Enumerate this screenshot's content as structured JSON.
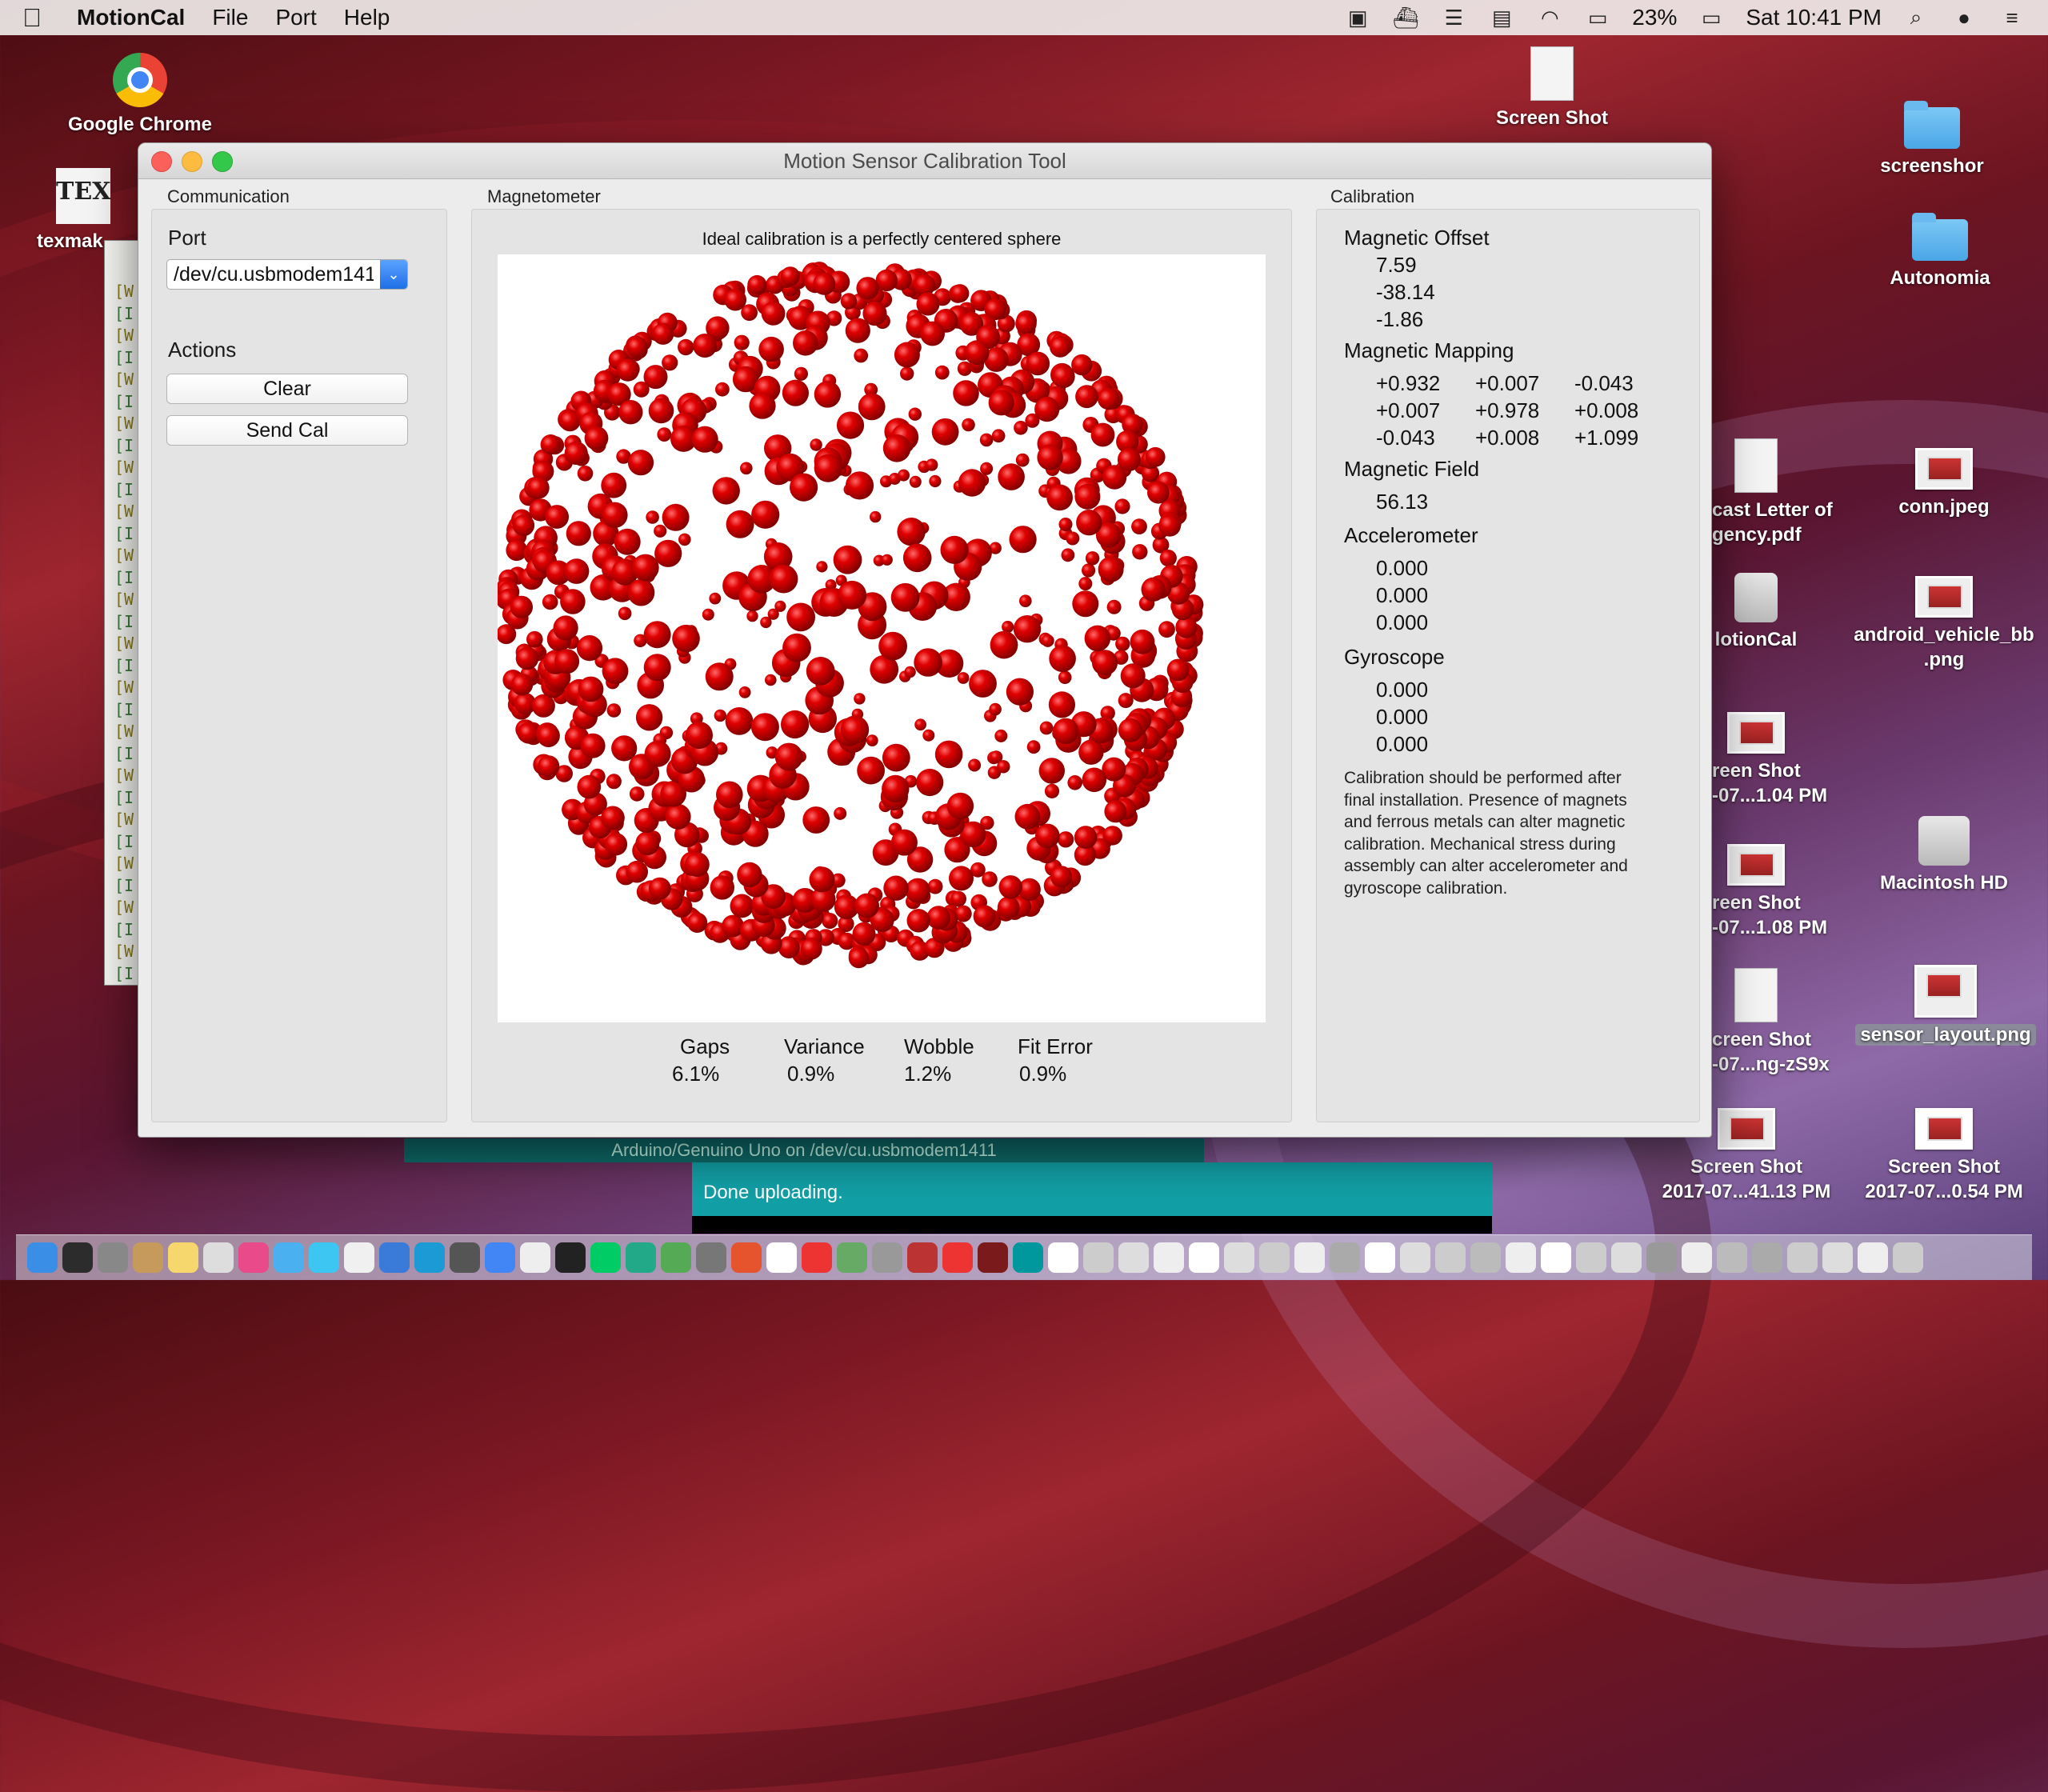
{
  "menubar": {
    "app_name": "MotionCal",
    "menus": [
      "File",
      "Port",
      "Help"
    ],
    "battery": "23%",
    "clock": "Sat 10:41 PM"
  },
  "desktop": {
    "icons": {
      "chrome": "Google Chrome",
      "texmaker": "texmak",
      "screenshot_top": "Screen Shot",
      "screenshor": "screenshor",
      "autonomia": "Autonomia",
      "letter_line1": "cast Letter of",
      "letter_line2": "gency.pdf",
      "conn": "conn.jpeg",
      "motioncal": "lotionCal",
      "android_line1": "android_vehicle_bb",
      "android_line2": ".png",
      "ss1_line1": "reen Shot",
      "ss1_line2": "-07...1.04 PM",
      "macintosh": "Macintosh HD",
      "ss2_line1": "reen Shot",
      "ss2_line2": "-07...1.08 PM",
      "ss3_line1": "creen Shot",
      "ss3_line2": "-07...ng-zS9x",
      "sensor_layout": "sensor_layout.png",
      "ss4_line1": "Screen Shot",
      "ss4_line2": "2017-07...41.13 PM",
      "ss5_line1": "Screen Shot",
      "ss5_line2": "2017-07...0.54 PM"
    }
  },
  "terminal": {
    "lines": [
      "[W",
      "[I",
      "[W",
      "[I",
      "[W",
      "[I",
      "[W",
      "[I",
      "[W",
      "[I",
      "[W",
      "[I",
      "[W",
      "[I",
      "[W",
      "[I",
      "[W",
      "[I",
      "[W",
      "[I",
      "[W",
      "[I",
      "[W",
      "[I",
      "[W",
      "[I",
      "[W",
      "[I",
      "[W",
      "[I",
      "[W",
      "[I"
    ]
  },
  "arduino": {
    "status_bar": "Arduino/Genuino Uno on /dev/cu.usbmodem1411",
    "message": "Done uploading."
  },
  "window": {
    "title": "Motion Sensor Calibration Tool",
    "communication": {
      "group_label": "Communication",
      "port_label": "Port",
      "port_value": "/dev/cu.usbmodem1411",
      "actions_label": "Actions",
      "clear_label": "Clear",
      "send_cal_label": "Send Cal"
    },
    "magnetometer": {
      "group_label": "Magnetometer",
      "caption": "Ideal calibration is a perfectly centered sphere",
      "stats": [
        {
          "label": "Gaps",
          "value": "6.1%"
        },
        {
          "label": "Variance",
          "value": "0.9%"
        },
        {
          "label": "Wobble",
          "value": "1.2%"
        },
        {
          "label": "Fit Error",
          "value": "0.9%"
        }
      ],
      "sphere_color": "#d40000"
    },
    "calibration": {
      "group_label": "Calibration",
      "offset_label": "Magnetic Offset",
      "offset": [
        "7.59",
        "-38.14",
        "-1.86"
      ],
      "mapping_label": "Magnetic Mapping",
      "mapping": [
        [
          "+0.932",
          "+0.007",
          "-0.043"
        ],
        [
          "+0.007",
          "+0.978",
          "+0.008"
        ],
        [
          "-0.043",
          "+0.008",
          "+1.099"
        ]
      ],
      "field_label": "Magnetic Field",
      "field": "56.13",
      "accel_label": "Accelerometer",
      "accel": [
        "0.000",
        "0.000",
        "0.000"
      ],
      "gyro_label": "Gyroscope",
      "gyro": [
        "0.000",
        "0.000",
        "0.000"
      ],
      "note": "Calibration should be performed after final installation.  Presence of magnets and ferrous metals can alter magnetic calibration. Mechanical stress during assembly can alter accelerometer and gyroscope calibration."
    }
  }
}
